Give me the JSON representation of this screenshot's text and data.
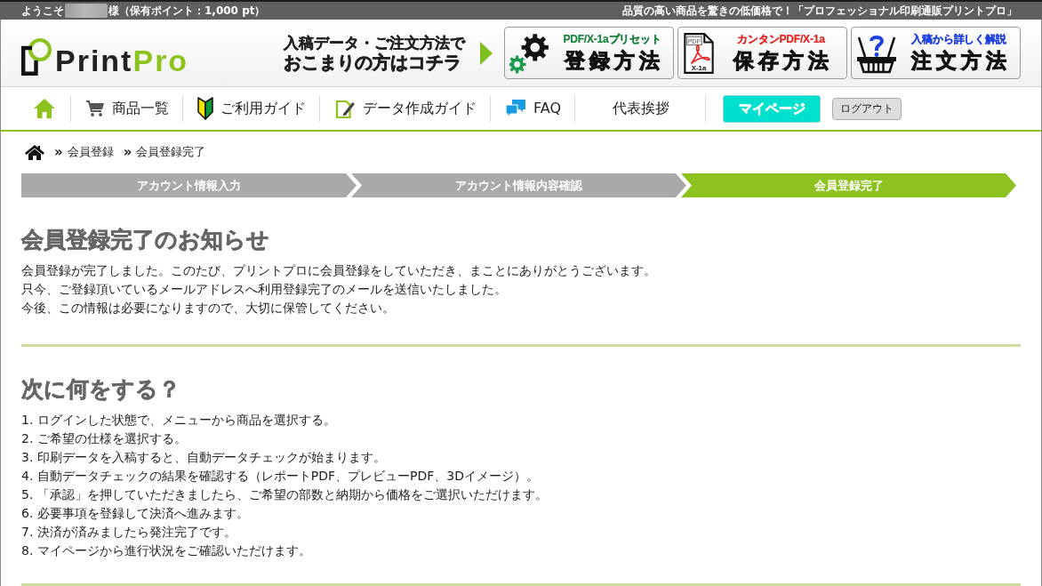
{
  "top_bar": {
    "greeting": "ようこそ",
    "points": "様（保有ポイント：1,000 pt）",
    "tagline": "品質の高い商品を驚きの低価格で！「プロフェッショナル印刷通販プリントプロ」"
  },
  "header": {
    "logo": {
      "first": "Print",
      "second": "Pro"
    },
    "help_lines": [
      "入稿データ・ご注文方法で",
      "おこまりの方はコチラ"
    ],
    "guide_buttons": [
      {
        "kind": "gears",
        "caption": "PDF/X-1aプリセット",
        "color": "#17803d",
        "label": "登録方法"
      },
      {
        "kind": "pdf",
        "caption": "カンタンPDF/X-1a",
        "color": "#e8231e",
        "label": "保存方法",
        "icon_labels": [
          "PDF",
          "X-1a"
        ]
      },
      {
        "kind": "basket",
        "caption": "入稿から詳しく解説",
        "color": "#1d3fe0",
        "label": "注文方法"
      }
    ]
  },
  "nav": {
    "items": [
      {
        "kind": "home"
      },
      {
        "kind": "cart",
        "label": "商品一覧"
      },
      {
        "kind": "beginner",
        "label": "ご利用ガイド"
      },
      {
        "kind": "document",
        "label": "データ作成ガイド"
      },
      {
        "kind": "chat",
        "label": "FAQ"
      },
      {
        "kind": "text",
        "label": "代表挨拶"
      }
    ],
    "mypage_button": "マイページ",
    "logout_button": "ログアウト"
  },
  "breadcrumb": [
    {
      "separator": "»",
      "label": "会員登録"
    },
    {
      "separator": "»",
      "label": "会員登録完了"
    }
  ],
  "steps": [
    {
      "label": "アカウント情報入力",
      "selected": false
    },
    {
      "label": "アカウント情報内容確認",
      "selected": false
    },
    {
      "label": "会員登録完了",
      "selected": true
    }
  ],
  "sections": [
    {
      "kind": "paragraphs",
      "title": "会員登録完了のお知らせ",
      "lines": [
        "会員登録が完了しました。このたび、プリントプロに会員登録をしていただき、まことにありがとうございます。",
        "只今、ご登録頂いているメールアドレスへ利用登録完了のメールを送信いたしました。",
        "今後、この情報は必要になりますので、大切に保管してください。"
      ]
    },
    {
      "kind": "numbered",
      "title": "次に何をする？",
      "lines": [
        "1. ログインした状態で、メニューから商品を選択する。",
        "2. ご希望の仕様を選択する。",
        "3. 印刷データを入稿すると、自動データチェックが始まります。",
        "4. 自動データチェックの結果を確認する（レポートPDF、プレビューPDF、3Dイメージ）。",
        "5. 「承認」を押していただきましたら、ご希望の部数と納期から価格をご選択いただけます。",
        "6. 必要事項を登録して決済へ進みます。",
        "7. 決済が済みましたら発注完了です。",
        "8. マイページから進行状況をご確認いただけます。"
      ]
    }
  ]
}
